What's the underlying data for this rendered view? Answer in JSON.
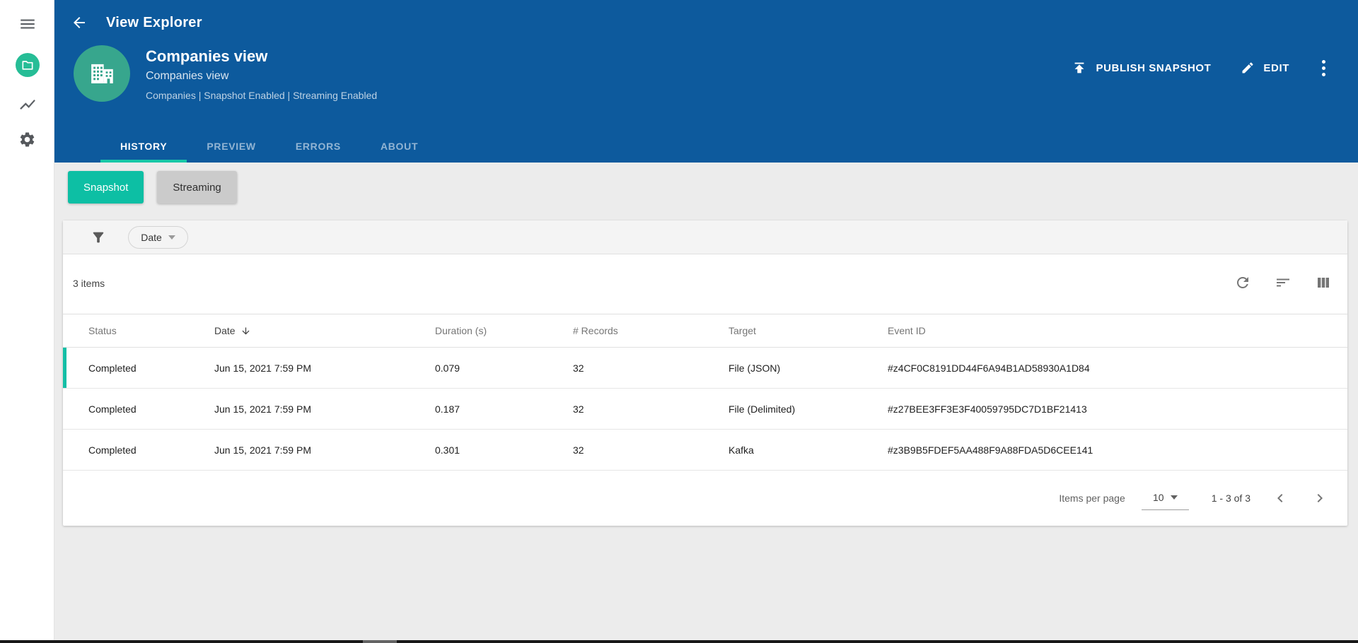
{
  "colors": {
    "header_blue": "#0d5a9d",
    "accent_teal": "#0dbfa4",
    "tab_underline": "#18c7a7",
    "avatar_green": "#37a68d",
    "sidebar_badge_green": "#26bd96",
    "row_indicator": "#13bfa6"
  },
  "sidebar": {
    "icons": [
      "menu-icon",
      "views-badge-folder-icon",
      "chart-icon",
      "settings-gear-icon"
    ]
  },
  "header": {
    "app_title": "View Explorer",
    "back_icon": "arrow-left",
    "view": {
      "title": "Companies view",
      "subtitle": "Companies view",
      "meta": "Companies | Snapshot Enabled | Streaming Enabled",
      "avatar_icon": "building"
    },
    "actions": {
      "publish_label": "PUBLISH SNAPSHOT",
      "publish_icon": "upload",
      "edit_label": "EDIT",
      "edit_icon": "pencil",
      "more_icon": "kebab-menu"
    },
    "tabs": [
      {
        "label": "HISTORY",
        "active": true
      },
      {
        "label": "PREVIEW",
        "active": false
      },
      {
        "label": "ERRORS",
        "active": false
      },
      {
        "label": "ABOUT",
        "active": false
      }
    ]
  },
  "toggles": {
    "snapshot_label": "Snapshot",
    "streaming_label": "Streaming",
    "selected": "Snapshot"
  },
  "filter": {
    "filter_icon": "funnel",
    "dropdown_label": "Date"
  },
  "table": {
    "items_count": "3 items",
    "toolbar_icons": [
      "refresh-icon",
      "sort-icon",
      "columns-icon"
    ],
    "columns": [
      {
        "label": "Status"
      },
      {
        "label": "Date",
        "sorted": "desc"
      },
      {
        "label": "Duration (s)"
      },
      {
        "label": "# Records"
      },
      {
        "label": "Target"
      },
      {
        "label": "Event ID"
      }
    ],
    "rows": [
      {
        "status": "Completed",
        "date": "Jun 15, 2021 7:59 PM",
        "duration": "0.079",
        "records": "32",
        "target": "File (JSON)",
        "event_id": "#z4CF0C8191DD44F6A94B1AD58930A1D84",
        "selected": true
      },
      {
        "status": "Completed",
        "date": "Jun 15, 2021 7:59 PM",
        "duration": "0.187",
        "records": "32",
        "target": "File (Delimited)",
        "event_id": "#z27BEE3FF3E3F40059795DC7D1BF21413",
        "selected": false
      },
      {
        "status": "Completed",
        "date": "Jun 15, 2021 7:59 PM",
        "duration": "0.301",
        "records": "32",
        "target": "Kafka",
        "event_id": "#z3B9B5FDEF5AA488F9A88FDA5D6CEE141",
        "selected": false
      }
    ],
    "pagination": {
      "items_per_page_label": "Items per page",
      "page_size": "10",
      "range": "1 - 3 of 3"
    }
  }
}
